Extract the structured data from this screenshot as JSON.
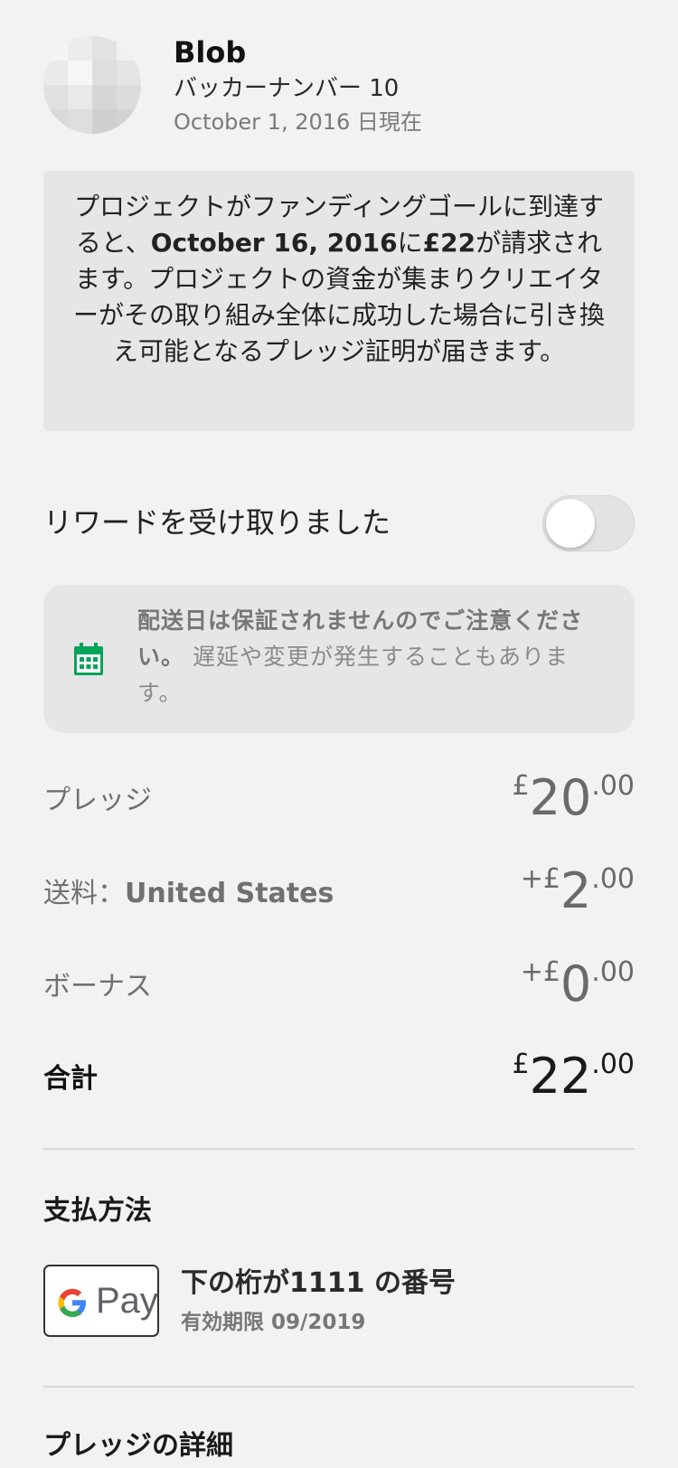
{
  "header": {
    "name": "Blob",
    "backer_number": "バッカーナンバー 10",
    "as_of": "October 1, 2016 日現在"
  },
  "notice": {
    "part1": "プロジェクトがファンディングゴールに到達すると、",
    "date": "October 16, 2016",
    "part2": "に",
    "amount": "£22",
    "part3": "が請求されます。プロジェクトの資金が集まりクリエイターがその取り組み全体に成功した場合に引き換え可能となるプレッジ証明が届きます。"
  },
  "reward": {
    "label": "リワードを受け取りました",
    "toggle_on": false
  },
  "delivery": {
    "icon": "calendar-icon",
    "strong_text": "配送日は保証されませんのでご注意ください。",
    "text": " 遅延や変更が発生することもあります。"
  },
  "amounts": {
    "pledge": {
      "label": "プレッジ",
      "currency": "£",
      "whole": "20",
      "cents": ".00"
    },
    "shipping": {
      "label": "送料：",
      "country": "United States",
      "currency": "+£",
      "whole": "2",
      "cents": ".00"
    },
    "bonus": {
      "label": "ボーナス",
      "currency": "+£",
      "whole": "0",
      "cents": ".00"
    },
    "total": {
      "label": "合計",
      "currency": "£",
      "whole": "22",
      "cents": ".00"
    }
  },
  "payment": {
    "title": "支払方法",
    "method_logo": "G Pay",
    "pay_text": "Pay",
    "card_line": "下の桁が1111 の番号",
    "expiry": "有効期限 09/2019"
  },
  "details": {
    "title": "プレッジの詳細"
  },
  "colors": {
    "background": "#f2f2f2",
    "box": "#e6e6e6",
    "calendar_green": "#05a45a"
  }
}
